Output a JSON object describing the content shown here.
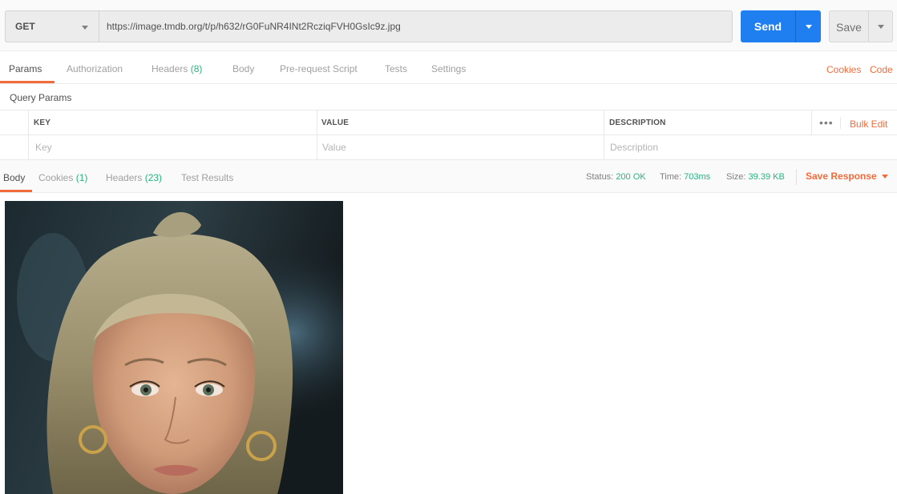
{
  "request": {
    "method": "GET",
    "url": "https://image.tmdb.org/t/p/h632/rG0FuNR4INt2RcziqFVH0GsIc9z.jpg",
    "send_label": "Send",
    "save_label": "Save"
  },
  "request_tabs": {
    "params": "Params",
    "authorization": "Authorization",
    "headers": "Headers",
    "headers_count": "(8)",
    "body": "Body",
    "pre_request_script": "Pre-request Script",
    "tests": "Tests",
    "settings": "Settings",
    "cookies_link": "Cookies",
    "code_link": "Code"
  },
  "query_params": {
    "title": "Query Params",
    "columns": {
      "key": "KEY",
      "value": "VALUE",
      "description": "DESCRIPTION"
    },
    "placeholders": {
      "key": "Key",
      "value": "Value",
      "description": "Description"
    },
    "bulk_edit": "Bulk Edit",
    "more": "•••"
  },
  "response": {
    "tabs": {
      "body": "Body",
      "cookies": "Cookies",
      "cookies_count": "(1)",
      "headers": "Headers",
      "headers_count": "(23)",
      "test_results": "Test Results"
    },
    "status_label": "Status:",
    "status_value": "200 OK",
    "time_label": "Time:",
    "time_value": "703ms",
    "size_label": "Size:",
    "size_value": "39.39 KB",
    "save_response": "Save Response"
  },
  "colors": {
    "accent": "#f26b3a",
    "send_button": "#1f7ff0",
    "success": "#26b47f"
  },
  "icons": {
    "method_caret": "chevron-down-icon",
    "send_caret": "chevron-down-icon",
    "save_caret": "chevron-down-icon",
    "more": "more-horizontal-icon"
  }
}
